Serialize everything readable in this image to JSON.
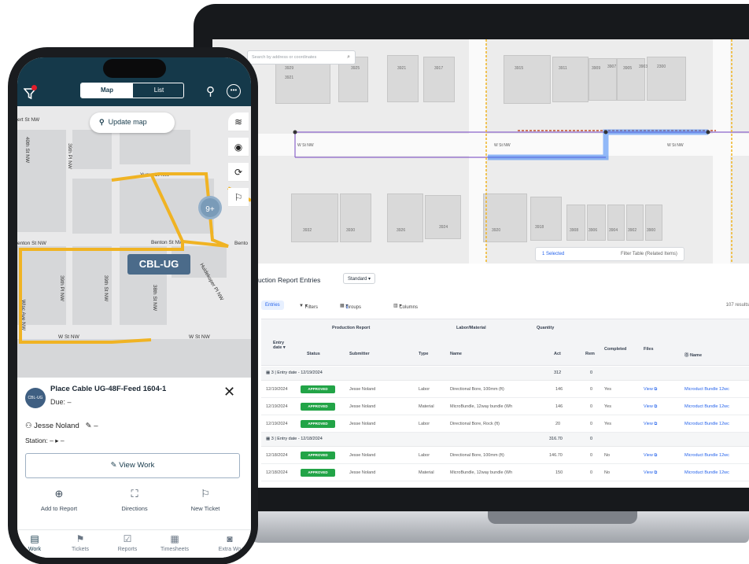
{
  "desktop": {
    "map": {
      "search_placeholder": "Search by address or coordinates",
      "house_numbers_top": [
        "3929",
        "3925",
        "3921",
        "3917",
        "3915",
        "3911",
        "3909",
        "3907",
        "3905",
        "3903",
        "2300",
        "3921"
      ],
      "house_numbers_bottom": [
        "3932",
        "3930",
        "3926",
        "3924",
        "3920",
        "3918",
        "3908",
        "3906",
        "3904",
        "3902",
        "3900"
      ],
      "street_main": "W St NW",
      "selection_bar": {
        "selected": "1 Selected",
        "filter": "Filter Table (Related Items)"
      }
    },
    "table": {
      "title": "Production Report Entries",
      "view": "Standard",
      "toolbar": {
        "entries": "Entries",
        "filters": "Filters",
        "groups": "Groups",
        "groups_count": "1",
        "columns": "Columns",
        "results": "107 results"
      },
      "group_headers": {
        "production_report": "Production Report",
        "labor_material": "Labor/Material",
        "quantity": "Quantity"
      },
      "columns": {
        "entry_date": "Entry date",
        "status": "Status",
        "submitter": "Submitter",
        "type": "Type",
        "name": "Name",
        "act": "Act",
        "rem": "Rem",
        "completed": "Completed",
        "files": "Files",
        "name2": "Name"
      },
      "groups": [
        {
          "label": "3 | Entry date - 12/19/2024",
          "act": "312",
          "rem": "0",
          "rows": [
            {
              "date": "12/19/2024",
              "status": "APPROVED",
              "submitter": "Jesse Noland",
              "type": "Labor",
              "name": "Directional Bore, 100mm (ft)",
              "act": "146",
              "rem": "0",
              "completed": "Yes",
              "files": "View",
              "item": "Microduct Bundle 12wc"
            },
            {
              "date": "12/19/2024",
              "status": "APPROVED",
              "submitter": "Jesse Noland",
              "type": "Material",
              "name": "MicroBundle, 12way bundle (Wh",
              "act": "146",
              "rem": "0",
              "completed": "Yes",
              "files": "View",
              "item": "Microduct Bundle 12wc"
            },
            {
              "date": "12/19/2024",
              "status": "APPROVED",
              "submitter": "Jesse Noland",
              "type": "Labor",
              "name": "Directional Bore, Rock (ft)",
              "act": "20",
              "rem": "0",
              "completed": "Yes",
              "files": "View",
              "item": "Microduct Bundle 12wc"
            }
          ]
        },
        {
          "label": "3 | Entry date - 12/18/2024",
          "act": "316.70",
          "rem": "0",
          "rows": [
            {
              "date": "12/18/2024",
              "status": "APPROVED",
              "submitter": "Jesse Noland",
              "type": "Labor",
              "name": "Directional Bore, 100mm (ft)",
              "act": "146.70",
              "rem": "0",
              "completed": "No",
              "files": "View",
              "item": "Microduct Bundle 12wc"
            },
            {
              "date": "12/18/2024",
              "status": "APPROVED",
              "submitter": "Jesse Noland",
              "type": "Material",
              "name": "MicroBundle, 12way bundle (Wh",
              "act": "150",
              "rem": "0",
              "completed": "No",
              "files": "View",
              "item": "Microduct Bundle 12wc"
            }
          ]
        }
      ]
    }
  },
  "phone": {
    "tabs": {
      "map": "Map",
      "list": "List"
    },
    "map": {
      "update_button": "Update map",
      "cluster_count": "9+",
      "cable_tag": "CBL-UG",
      "streets": [
        "ert St NW",
        "39th Pl NW",
        "Yuma St NW",
        "Benton St NW",
        "enton St NW",
        "W St NW",
        "W St NW",
        "39th Pl NW",
        "39th St NW",
        "38th St NW",
        "Huidekoper Pl NW",
        "Wisc Ave NW",
        "40th St NW",
        "Bento"
      ]
    },
    "sheet": {
      "avatar_text": "CBL-UG",
      "title": "Place Cable UG-48F-Feed 1604-1",
      "due": "Due: –",
      "assignee": "Jesse Noland",
      "assignee_extra": "–",
      "station": "Station: – ▸ –",
      "view_work": "View Work",
      "actions": [
        "Add to Report",
        "Directions",
        "New Ticket"
      ]
    },
    "nav": [
      "Work",
      "Tickets",
      "Reports",
      "Timesheets",
      "Extra Wo"
    ]
  },
  "colors": {
    "cable": "#f0b323",
    "header": "#15394a",
    "selection": "#3b82f6",
    "approved": "#22a447"
  }
}
